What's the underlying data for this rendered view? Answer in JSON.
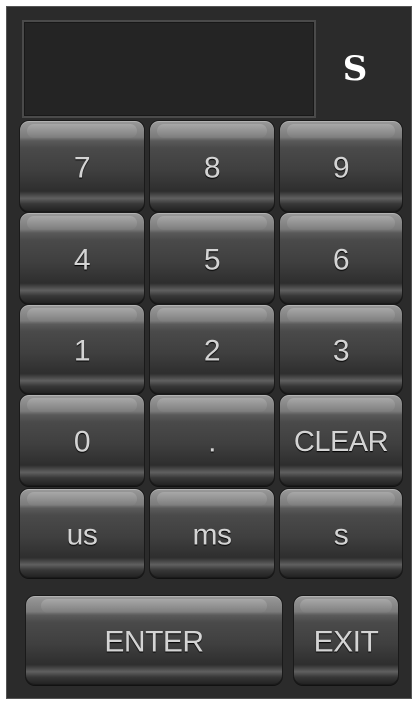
{
  "display": {
    "value": "",
    "unit": "S"
  },
  "keys": {
    "k7": "7",
    "k8": "8",
    "k9": "9",
    "k4": "4",
    "k5": "5",
    "k6": "6",
    "k1": "1",
    "k2": "2",
    "k3": "3",
    "k0": "0",
    "dot": ".",
    "clear": "CLEAR",
    "us": "us",
    "ms": "ms",
    "s": "s",
    "enter": "ENTER",
    "exit": "EXIT"
  }
}
